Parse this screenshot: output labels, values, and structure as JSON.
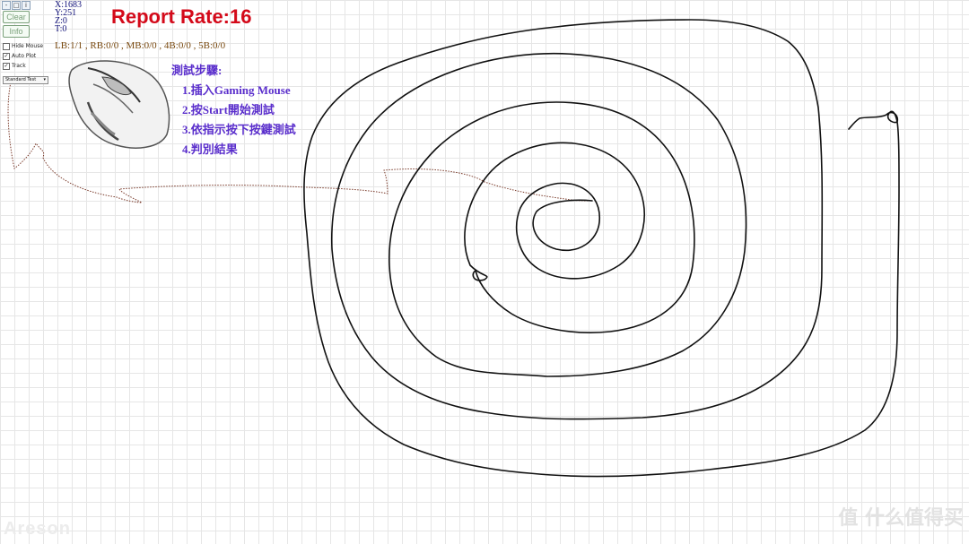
{
  "toolbar": {
    "window_buttons": [
      "-",
      "□",
      "i"
    ],
    "clear_label": "Clear",
    "info_label": "Info",
    "hide_mouse_label": "Hide Mouse",
    "auto_plot_label": "Auto Plot",
    "track_label": "Track",
    "hide_mouse_checked": "",
    "auto_plot_checked": "✓",
    "track_checked": "✓",
    "mode_select_value": "Standard Test",
    "mode_select_arrow": "▾"
  },
  "readout": {
    "x": "X:1683",
    "y": "Y:251",
    "z": "Z:0",
    "t": "T:0"
  },
  "report_rate": "Report Rate:16",
  "button_counts": "LB:1/1 , RB:0/0 , MB:0/0 , 4B:0/0 , 5B:0/0",
  "instructions": {
    "heading": "測試步驟:",
    "steps": [
      "1.插入Gaming Mouse",
      "2.按Start開始測試",
      "3.依指示按下按鍵測試",
      "4.判別結果"
    ]
  },
  "watermarks": {
    "left": "Areson",
    "right": "值 什么值得买"
  },
  "colors": {
    "title": "#d40a1a",
    "instructions": "#5a2ecc",
    "counts": "#7a4a10",
    "readout": "#12127a",
    "trace": "#111111",
    "trace_faded": "#7a3a2a"
  }
}
